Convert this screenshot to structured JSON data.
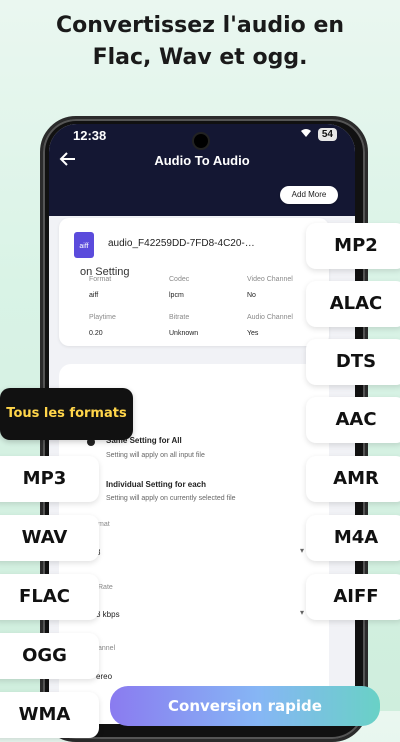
{
  "headline": {
    "line1": "Convertissez l'audio en",
    "line2": "Flac, Wav et ogg."
  },
  "status_bar": {
    "time": "12:38",
    "battery": "54"
  },
  "app_bar": {
    "title": "Audio To Audio"
  },
  "add_more": "Add More",
  "file_card": {
    "icon_text": "aiff",
    "file_name": "audio_F42259DD-7FD8-4C20-…",
    "fields": [
      {
        "label": "Format",
        "value": "aiff"
      },
      {
        "label": "Codec",
        "value": "lpcm"
      },
      {
        "label": "Video Channel",
        "value": "No"
      },
      {
        "label": "Playtime",
        "value": "0.20"
      },
      {
        "label": "Bitrate",
        "value": "Unknown"
      },
      {
        "label": "Audio Channel",
        "value": "Yes"
      }
    ]
  },
  "settings": {
    "title_partial": "on Setting",
    "options": [
      {
        "title": "Same Setting for All",
        "sub": "Setting will apply on all input file"
      },
      {
        "title": "Individual Setting for each",
        "sub": "Setting will apply on currently selected file"
      }
    ],
    "format_label": "mat",
    "format_value": "3",
    "rate_label": "Rate",
    "rate_value": "3 kbps",
    "channel_label": "annel",
    "channel_value": "ereo"
  },
  "formats_badge": "Tous les formats",
  "right_formats": [
    "MP2",
    "ALAC",
    "DTS",
    "AAC",
    "AMR",
    "M4A",
    "AIFF"
  ],
  "left_formats": [
    "MP3",
    "WAV",
    "FLAC",
    "OGG",
    "WMA"
  ],
  "convert_label": "Conversion rapide"
}
